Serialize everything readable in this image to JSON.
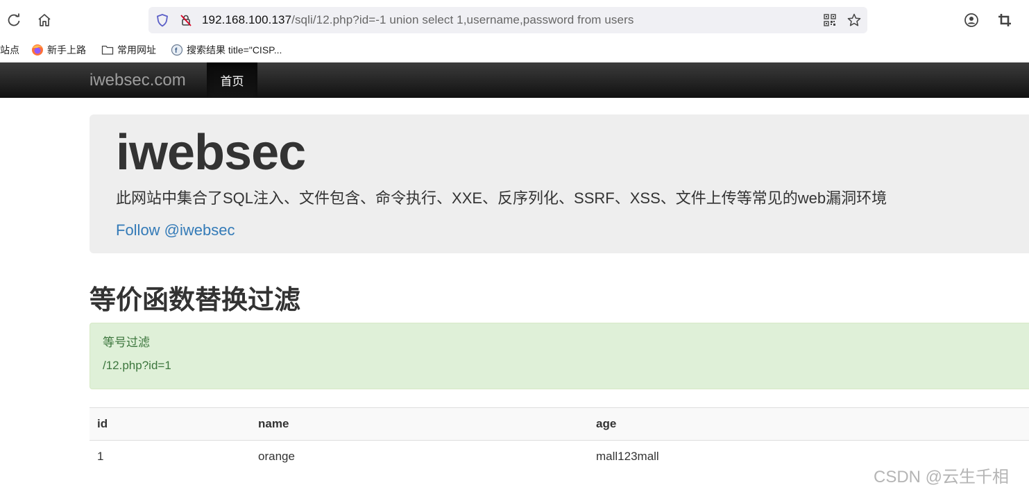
{
  "browser": {
    "url_host": "192.168.100.137",
    "url_rest": "/sqli/12.php?id=-1 union select 1,username,password from users",
    "bookmarks": [
      {
        "label": "站点"
      },
      {
        "label": "新手上路"
      },
      {
        "label": "常用网址"
      },
      {
        "label": "搜索结果 title=\"CISP..."
      }
    ]
  },
  "navbar": {
    "brand": "iwebsec.com",
    "active_item": "首页"
  },
  "jumbotron": {
    "title": "iwebsec",
    "lead": "此网站中集合了SQL注入、文件包含、命令执行、XXE、反序列化、SSRF、XSS、文件上传等常见的web漏洞环境",
    "follow": "Follow @iwebsec"
  },
  "page_heading": "等价函数替换过滤",
  "alert": {
    "line1": "等号过滤",
    "line2": "/12.php?id=1"
  },
  "table": {
    "headers": [
      "id",
      "name",
      "age"
    ],
    "rows": [
      [
        "1",
        "orange",
        "mall123mall"
      ]
    ]
  },
  "watermark": "CSDN @云生千相",
  "colors": {
    "navbar": "#222222",
    "jumbotron_bg": "#eeeeee",
    "alert_bg": "#dff0d8",
    "alert_text": "#3c763d",
    "link": "#337ab7"
  }
}
